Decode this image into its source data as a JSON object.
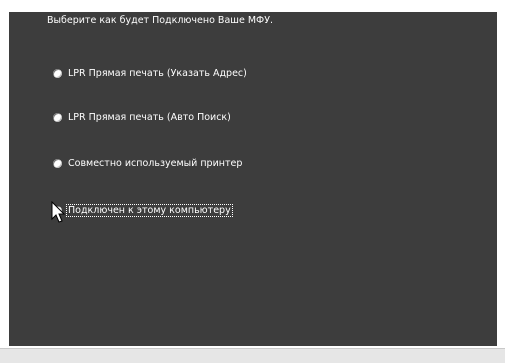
{
  "prompt": "Выберите как будет Подключено Ваше МФУ.",
  "options": [
    {
      "label": "LPR Прямая печать (Указать Адрес)",
      "selected": false
    },
    {
      "label": "LPR Прямая печать (Авто Поиск)",
      "selected": false
    },
    {
      "label": "Совместно используемый принтер",
      "selected": false
    },
    {
      "label": "Подключен к этому компьютеру",
      "selected": true
    }
  ],
  "colors": {
    "panel_background": "#3d3d3d",
    "text": "#ffffff"
  }
}
